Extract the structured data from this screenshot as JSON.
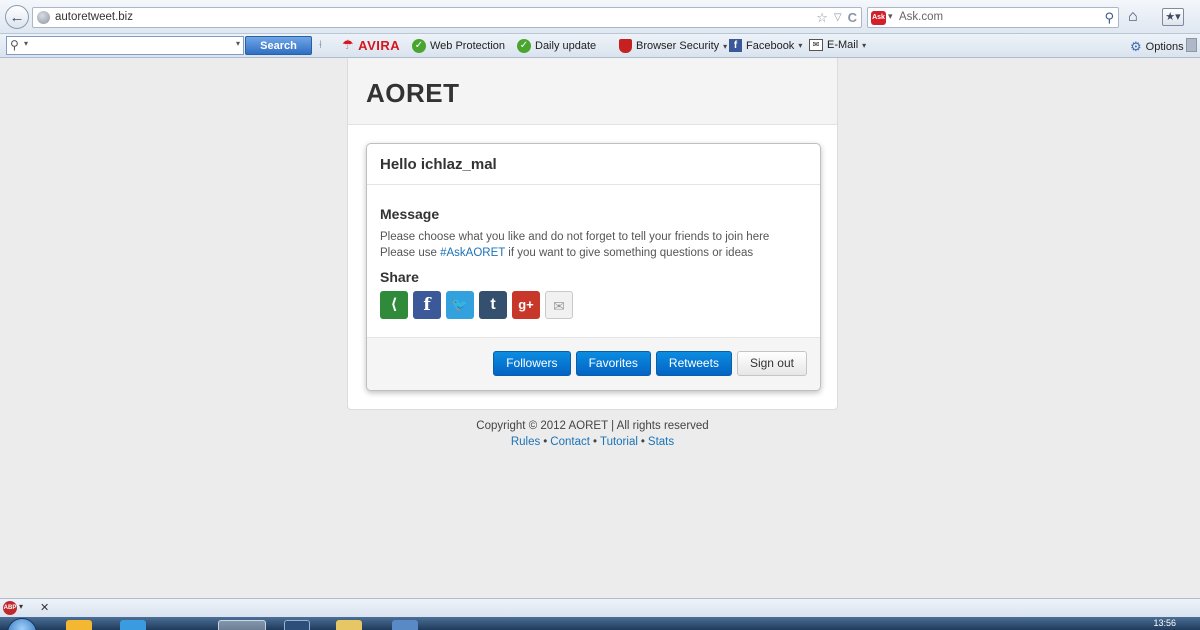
{
  "browser": {
    "url": "autoretweet.biz",
    "search_engine_placeholder": "Ask.com",
    "back_glyph": "←",
    "star_glyph": "☆",
    "dropdown_glyph": "▽",
    "reload_glyph": "C",
    "ask_logo_text": "Ask",
    "home_glyph": "⌂"
  },
  "toolbar": {
    "search_button": "Search",
    "avira_label": "AVIRA",
    "items": {
      "web_protection": "Web Protection",
      "daily_update": "Daily update",
      "browser_security": "Browser Security",
      "facebook": "Facebook",
      "email": "E-Mail",
      "options": "Options"
    }
  },
  "page": {
    "site_title": "AORET",
    "greeting": "Hello ichlaz_mal",
    "message_heading": "Message",
    "message_line1": "Please choose what you like and do not forget to tell your friends to join here",
    "message_line2_pre": "Please use ",
    "message_hashtag": "#AskAORET",
    "message_line2_post": " if you want to give something questions or ideas",
    "share_heading": "Share",
    "share_icons": [
      "share-icon",
      "facebook-icon",
      "twitter-icon",
      "tumblr-icon",
      "google-plus-icon",
      "email-icon"
    ],
    "buttons": {
      "followers": "Followers",
      "favorites": "Favorites",
      "retweets": "Retweets",
      "sign_out": "Sign out"
    }
  },
  "footer": {
    "copyright": "Copyright © 2012 AORET | All rights reserved",
    "links": {
      "rules": "Rules",
      "contact": "Contact",
      "tutorial": "Tutorial",
      "stats": "Stats"
    }
  },
  "taskbar": {
    "clock": "13:56",
    "abp_label": "ABP"
  },
  "colors": {
    "primary_button": "#0a77d4",
    "link": "#1a73b8",
    "avira_red": "#d7151e",
    "page_background": "#ececec"
  }
}
